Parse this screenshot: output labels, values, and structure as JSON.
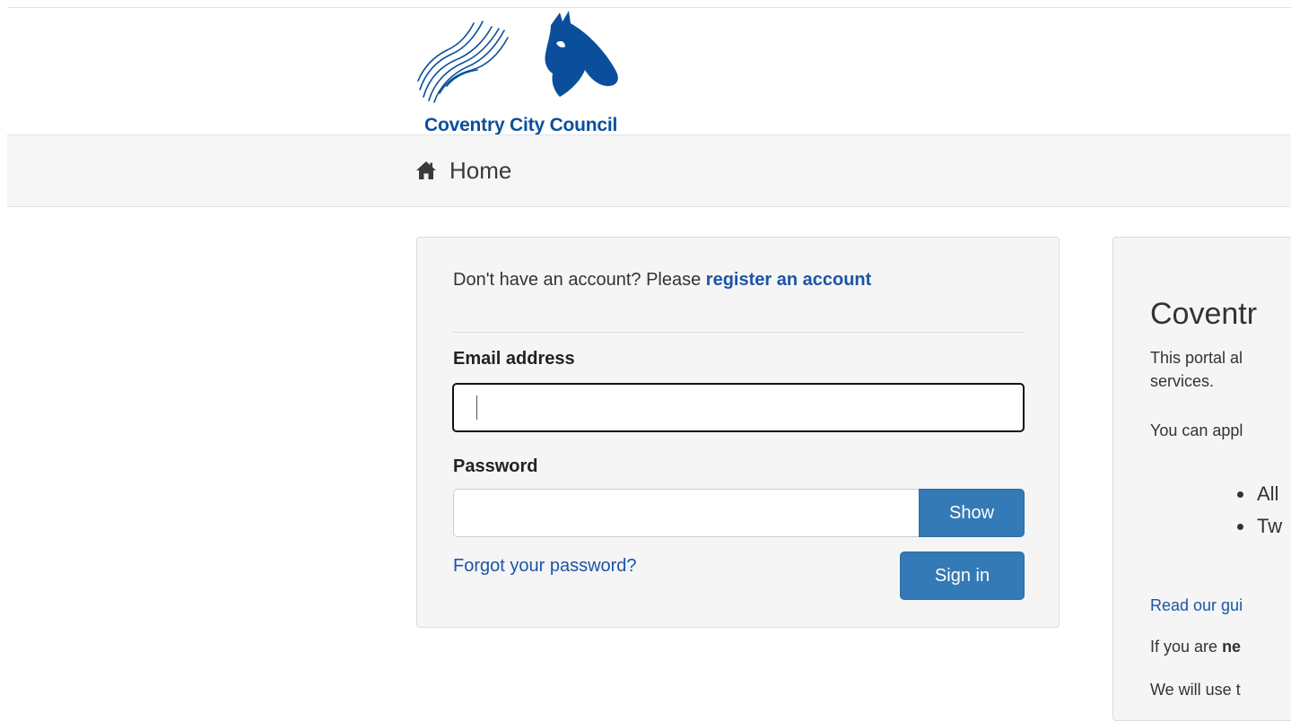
{
  "brand": {
    "logo_text": "Coventry City Council",
    "color": "#0b4f9c"
  },
  "nav": {
    "home_icon": "home-icon",
    "home_label": "Home"
  },
  "login": {
    "register_prompt": "Don't have an account? Please",
    "register_link": "register an account",
    "email_label": "Email address",
    "email_value": "",
    "password_label": "Password",
    "password_value": "",
    "show_label": "Show",
    "forgot_label": "Forgot your password?",
    "signin_label": "Sign in"
  },
  "info": {
    "title": "Coventr",
    "intro_line1": "This portal al",
    "intro_line2": "services.",
    "apply_line": "You can appl",
    "items": [
      "All",
      "Tw"
    ],
    "guide_link": "Read our gui",
    "new_prefix": "If you are",
    "new_bold": "ne",
    "use_line": "We will use t"
  },
  "colors": {
    "accent": "#337ab7",
    "link": "#1b55a6",
    "panel_bg": "#f5f5f5",
    "navbar_bg": "#f6f6f6"
  }
}
